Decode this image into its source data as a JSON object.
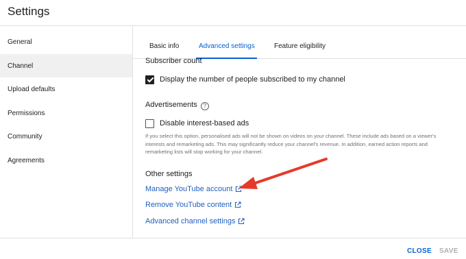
{
  "header": {
    "title": "Settings"
  },
  "sidebar": {
    "items": [
      {
        "label": "General"
      },
      {
        "label": "Channel"
      },
      {
        "label": "Upload defaults"
      },
      {
        "label": "Permissions"
      },
      {
        "label": "Community"
      },
      {
        "label": "Agreements"
      }
    ],
    "active": "Channel"
  },
  "tabs": [
    {
      "label": "Basic info"
    },
    {
      "label": "Advanced settings"
    },
    {
      "label": "Feature eligibility"
    }
  ],
  "active_tab": "Advanced settings",
  "content": {
    "subscriber_count": {
      "title": "Subscriber count",
      "checkbox_label": "Display the number of people subscribed to my channel",
      "checked": true
    },
    "advertisements": {
      "title": "Advertisements",
      "help_icon": "help-circle-icon",
      "checkbox_label": "Disable interest-based ads",
      "checked": false,
      "description": "If you select this option, personalised ads will not be shown on videos on your channel. These include ads based on a viewer's interests and remarketing ads. This may significantly reduce your channel's revenue. In addition, earned action reports and remarketing lists will stop working for your channel."
    },
    "other_settings": {
      "title": "Other settings",
      "links": [
        {
          "label": "Manage YouTube account",
          "icon": "external-link-icon"
        },
        {
          "label": "Remove YouTube content",
          "icon": "external-link-icon"
        },
        {
          "label": "Advanced channel settings",
          "icon": "external-link-icon"
        }
      ]
    }
  },
  "footer": {
    "close_label": "CLOSE",
    "save_label": "SAVE"
  },
  "colors": {
    "accent": "#065fd4",
    "link": "#1f5fbf",
    "annotation_arrow": "#e53a2a",
    "disabled": "#b0b0b0"
  }
}
